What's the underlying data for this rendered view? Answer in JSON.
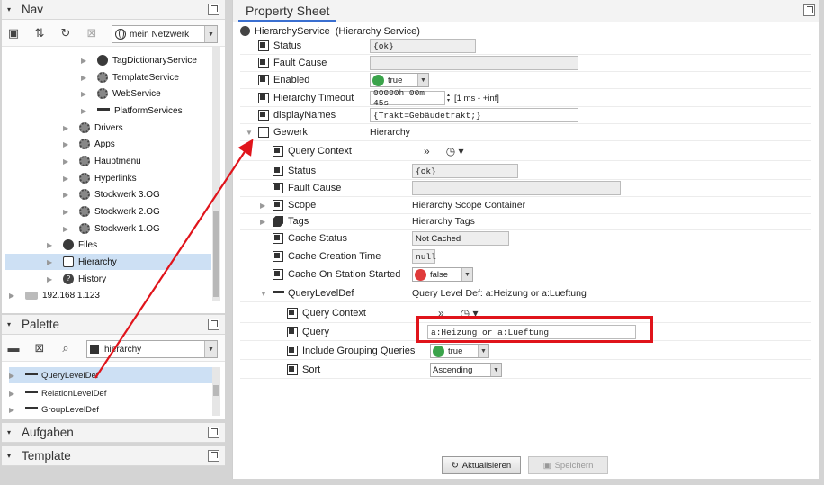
{
  "nav": {
    "title": "Nav",
    "station_select": "mein Netzwerk",
    "tree": [
      {
        "label": "TagDictionaryService",
        "icon": "gear-icon"
      },
      {
        "label": "TemplateService",
        "icon": "gear-icon"
      },
      {
        "label": "WebService",
        "icon": "gear-icon"
      },
      {
        "label": "PlatformServices",
        "icon": "service-bar-icon"
      },
      {
        "label": "Drivers",
        "icon": "folder-icon"
      },
      {
        "label": "Apps",
        "icon": "folder-icon"
      },
      {
        "label": "Hauptmenu",
        "icon": "folder-icon"
      },
      {
        "label": "Hyperlinks",
        "icon": "folder-icon"
      },
      {
        "label": "Stockwerk 3.OG",
        "icon": "folder-icon"
      },
      {
        "label": "Stockwerk 2.OG",
        "icon": "folder-icon"
      },
      {
        "label": "Stockwerk 1.OG",
        "icon": "folder-icon"
      },
      {
        "label": "Files",
        "icon": "folder-icon"
      },
      {
        "label": "Hierarchy",
        "icon": "hierarchy-icon"
      },
      {
        "label": "History",
        "icon": "history-icon"
      },
      {
        "label": "192.168.1.123",
        "icon": "host-icon"
      }
    ]
  },
  "palette": {
    "title": "Palette",
    "module_select": "hierarchy",
    "items": [
      "QueryLevelDef",
      "RelationLevelDef",
      "GroupLevelDef"
    ]
  },
  "aufgaben": {
    "title": "Aufgaben"
  },
  "template": {
    "title": "Template"
  },
  "sheet": {
    "tab": "Property Sheet",
    "root_name": "HierarchyService",
    "root_type": "(Hierarchy Service)",
    "status_label": "Status",
    "status_value": "{ok}",
    "fault_label": "Fault Cause",
    "enabled_label": "Enabled",
    "enabled_value": "true",
    "timeout_label": "Hierarchy Timeout",
    "timeout_value": "00000h 00m 45s",
    "timeout_range": "[1 ms - +inf]",
    "display_label": "displayNames",
    "display_value": "{Trakt=Gebäudetrakt;}",
    "gewerk_label": "Gewerk",
    "gewerk_value": "Hierarchy",
    "qc_label": "Query Context",
    "g_status_label": "Status",
    "g_status_value": "{ok}",
    "g_fault_label": "Fault Cause",
    "scope_label": "Scope",
    "scope_value": "Hierarchy Scope Container",
    "tags_label": "Tags",
    "tags_value": "Hierarchy Tags",
    "cache_status_label": "Cache Status",
    "cache_status_value": "Not Cached",
    "cache_time_label": "Cache Creation Time",
    "cache_time_value": "null",
    "cache_start_label": "Cache On Station Started",
    "cache_start_value": "false",
    "qld_label": "QueryLevelDef",
    "qld_value": "Query Level Def: a:Heizung or a:Lueftung",
    "qld_qc_label": "Query Context",
    "query_label": "Query",
    "query_value": "a:Heizung or a:Lueftung",
    "igq_label": "Include Grouping Queries",
    "igq_value": "true",
    "sort_label": "Sort",
    "sort_value": "Ascending"
  },
  "buttons": {
    "refresh": "Aktualisieren",
    "save": "Speichern"
  },
  "colors": {
    "highlight_red": "#e0141b",
    "selection": "#cde0f4",
    "accent": "#3a6fd0"
  }
}
